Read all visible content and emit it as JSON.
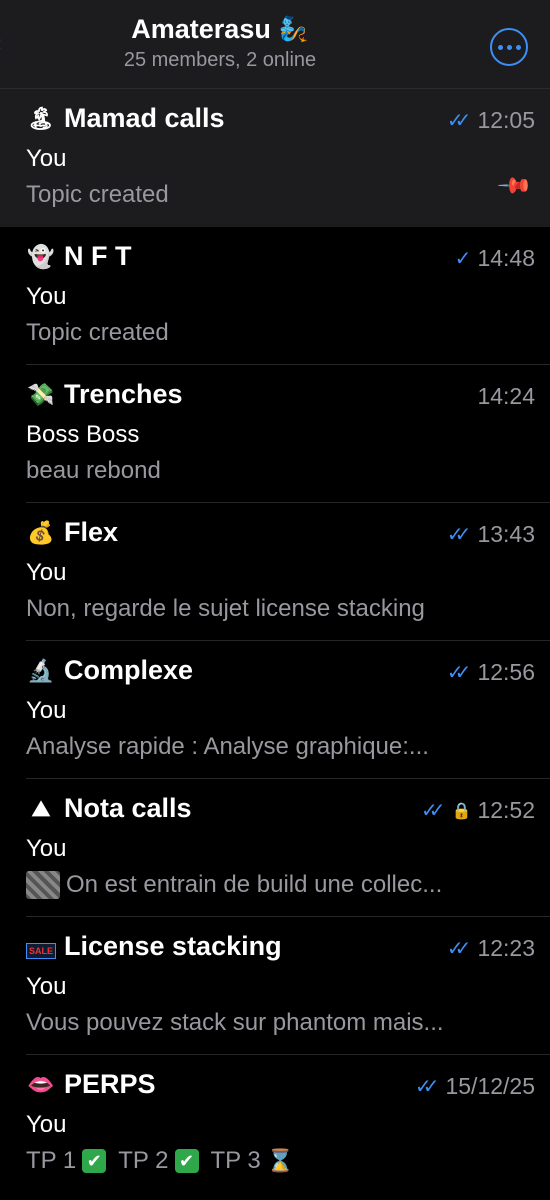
{
  "header": {
    "title": "Amaterasu",
    "title_emoji": "🧞",
    "subtitle": "25 members, 2 online"
  },
  "topics": [
    {
      "icon": "🏝",
      "title": "Mamad calls",
      "time": "12:05",
      "check": "double",
      "sender": "You",
      "preview": "Topic created",
      "pinned": true
    },
    {
      "icon": "👻",
      "title": "N F T",
      "time": "14:48",
      "check": "single",
      "sender": "You",
      "preview": "Topic created"
    },
    {
      "icon": "💸",
      "title": "Trenches",
      "time": "14:24",
      "check": "none",
      "sender": "Boss Boss",
      "preview": "beau rebond"
    },
    {
      "icon": "💰",
      "title": "Flex",
      "time": "13:43",
      "check": "double",
      "sender": "You",
      "preview": "Non, regarde le sujet license stacking"
    },
    {
      "icon": "🔬",
      "title": "Complexe",
      "time": "12:56",
      "check": "double",
      "sender": "You",
      "preview": "Analyse rapide : Analyse graphique:..."
    },
    {
      "icon": "⛰",
      "title": "Nota calls",
      "time": "12:52",
      "check": "double",
      "locked": true,
      "sender": "You",
      "preview": "On est entrain de build une collec..."
    },
    {
      "icon": "SALE",
      "title": "License stacking",
      "time": "12:23",
      "check": "double",
      "sender": "You",
      "preview": "Vous pouvez stack sur phantom mais..."
    },
    {
      "icon": "👄",
      "title": "PERPS",
      "time": "15/12/25",
      "check": "double",
      "sender": "You",
      "preview_parts": [
        "TP 1",
        "TP 2",
        "TP 3"
      ]
    }
  ],
  "icons": {
    "more": "ellipsis-circle-icon",
    "pin": "pin-icon",
    "lock": "lock-icon",
    "double_check": "double-check-icon",
    "single_check": "single-check-icon"
  },
  "colors": {
    "accent": "#3d8ff5",
    "background": "#000000",
    "header_bg": "#1c1c1e",
    "secondary_text": "#98989f"
  }
}
